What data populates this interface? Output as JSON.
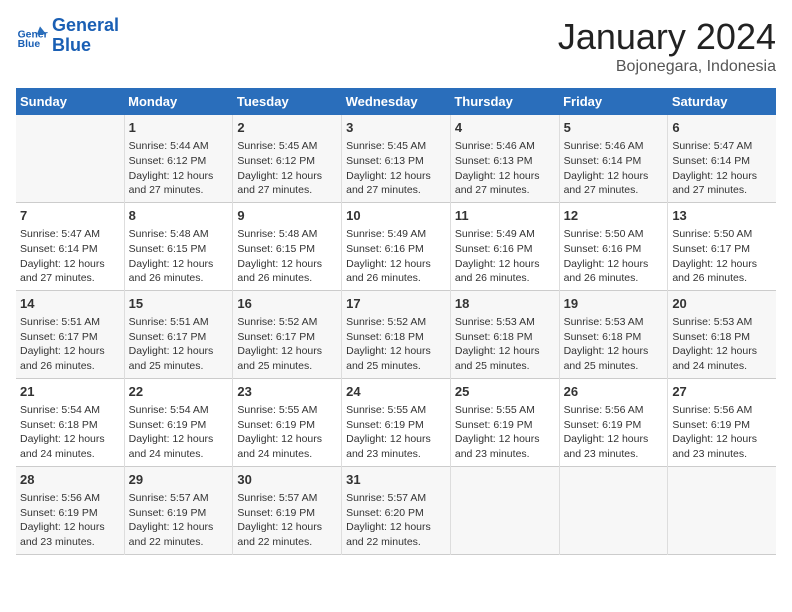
{
  "header": {
    "logo_line1": "General",
    "logo_line2": "Blue",
    "title": "January 2024",
    "subtitle": "Bojonegara, Indonesia"
  },
  "days_of_week": [
    "Sunday",
    "Monday",
    "Tuesday",
    "Wednesday",
    "Thursday",
    "Friday",
    "Saturday"
  ],
  "weeks": [
    [
      {
        "day": "",
        "info": ""
      },
      {
        "day": "1",
        "info": "Sunrise: 5:44 AM\nSunset: 6:12 PM\nDaylight: 12 hours\nand 27 minutes."
      },
      {
        "day": "2",
        "info": "Sunrise: 5:45 AM\nSunset: 6:12 PM\nDaylight: 12 hours\nand 27 minutes."
      },
      {
        "day": "3",
        "info": "Sunrise: 5:45 AM\nSunset: 6:13 PM\nDaylight: 12 hours\nand 27 minutes."
      },
      {
        "day": "4",
        "info": "Sunrise: 5:46 AM\nSunset: 6:13 PM\nDaylight: 12 hours\nand 27 minutes."
      },
      {
        "day": "5",
        "info": "Sunrise: 5:46 AM\nSunset: 6:14 PM\nDaylight: 12 hours\nand 27 minutes."
      },
      {
        "day": "6",
        "info": "Sunrise: 5:47 AM\nSunset: 6:14 PM\nDaylight: 12 hours\nand 27 minutes."
      }
    ],
    [
      {
        "day": "7",
        "info": "Sunrise: 5:47 AM\nSunset: 6:14 PM\nDaylight: 12 hours\nand 27 minutes."
      },
      {
        "day": "8",
        "info": "Sunrise: 5:48 AM\nSunset: 6:15 PM\nDaylight: 12 hours\nand 26 minutes."
      },
      {
        "day": "9",
        "info": "Sunrise: 5:48 AM\nSunset: 6:15 PM\nDaylight: 12 hours\nand 26 minutes."
      },
      {
        "day": "10",
        "info": "Sunrise: 5:49 AM\nSunset: 6:16 PM\nDaylight: 12 hours\nand 26 minutes."
      },
      {
        "day": "11",
        "info": "Sunrise: 5:49 AM\nSunset: 6:16 PM\nDaylight: 12 hours\nand 26 minutes."
      },
      {
        "day": "12",
        "info": "Sunrise: 5:50 AM\nSunset: 6:16 PM\nDaylight: 12 hours\nand 26 minutes."
      },
      {
        "day": "13",
        "info": "Sunrise: 5:50 AM\nSunset: 6:17 PM\nDaylight: 12 hours\nand 26 minutes."
      }
    ],
    [
      {
        "day": "14",
        "info": "Sunrise: 5:51 AM\nSunset: 6:17 PM\nDaylight: 12 hours\nand 26 minutes."
      },
      {
        "day": "15",
        "info": "Sunrise: 5:51 AM\nSunset: 6:17 PM\nDaylight: 12 hours\nand 25 minutes."
      },
      {
        "day": "16",
        "info": "Sunrise: 5:52 AM\nSunset: 6:17 PM\nDaylight: 12 hours\nand 25 minutes."
      },
      {
        "day": "17",
        "info": "Sunrise: 5:52 AM\nSunset: 6:18 PM\nDaylight: 12 hours\nand 25 minutes."
      },
      {
        "day": "18",
        "info": "Sunrise: 5:53 AM\nSunset: 6:18 PM\nDaylight: 12 hours\nand 25 minutes."
      },
      {
        "day": "19",
        "info": "Sunrise: 5:53 AM\nSunset: 6:18 PM\nDaylight: 12 hours\nand 25 minutes."
      },
      {
        "day": "20",
        "info": "Sunrise: 5:53 AM\nSunset: 6:18 PM\nDaylight: 12 hours\nand 24 minutes."
      }
    ],
    [
      {
        "day": "21",
        "info": "Sunrise: 5:54 AM\nSunset: 6:18 PM\nDaylight: 12 hours\nand 24 minutes."
      },
      {
        "day": "22",
        "info": "Sunrise: 5:54 AM\nSunset: 6:19 PM\nDaylight: 12 hours\nand 24 minutes."
      },
      {
        "day": "23",
        "info": "Sunrise: 5:55 AM\nSunset: 6:19 PM\nDaylight: 12 hours\nand 24 minutes."
      },
      {
        "day": "24",
        "info": "Sunrise: 5:55 AM\nSunset: 6:19 PM\nDaylight: 12 hours\nand 23 minutes."
      },
      {
        "day": "25",
        "info": "Sunrise: 5:55 AM\nSunset: 6:19 PM\nDaylight: 12 hours\nand 23 minutes."
      },
      {
        "day": "26",
        "info": "Sunrise: 5:56 AM\nSunset: 6:19 PM\nDaylight: 12 hours\nand 23 minutes."
      },
      {
        "day": "27",
        "info": "Sunrise: 5:56 AM\nSunset: 6:19 PM\nDaylight: 12 hours\nand 23 minutes."
      }
    ],
    [
      {
        "day": "28",
        "info": "Sunrise: 5:56 AM\nSunset: 6:19 PM\nDaylight: 12 hours\nand 23 minutes."
      },
      {
        "day": "29",
        "info": "Sunrise: 5:57 AM\nSunset: 6:19 PM\nDaylight: 12 hours\nand 22 minutes."
      },
      {
        "day": "30",
        "info": "Sunrise: 5:57 AM\nSunset: 6:19 PM\nDaylight: 12 hours\nand 22 minutes."
      },
      {
        "day": "31",
        "info": "Sunrise: 5:57 AM\nSunset: 6:20 PM\nDaylight: 12 hours\nand 22 minutes."
      },
      {
        "day": "",
        "info": ""
      },
      {
        "day": "",
        "info": ""
      },
      {
        "day": "",
        "info": ""
      }
    ]
  ]
}
